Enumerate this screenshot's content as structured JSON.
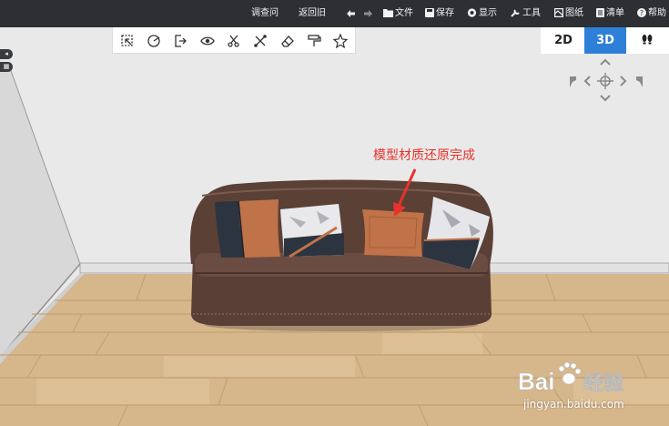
{
  "topbar": {
    "items": [
      {
        "label": "调查问"
      },
      {
        "label": "返回旧"
      },
      {
        "label": "文件",
        "icon": "folder-icon"
      },
      {
        "label": "保存",
        "icon": "save-icon"
      },
      {
        "label": "显示",
        "icon": "eye-icon"
      },
      {
        "label": "工具",
        "icon": "wrench-icon"
      },
      {
        "label": "图纸",
        "icon": "drawing-icon"
      },
      {
        "label": "清单",
        "icon": "list-icon"
      },
      {
        "label": "帮助",
        "icon": "help-icon"
      }
    ],
    "undo_icon": "undo-icon",
    "redo_icon": "redo-icon"
  },
  "palette": {
    "tools": [
      "select-icon",
      "material-brush-icon",
      "exit-group-icon",
      "visibility-icon",
      "cut-icon",
      "scissors-x-icon",
      "eraser-icon",
      "paint-roller-icon",
      "favorite-star-icon"
    ]
  },
  "view_switch": {
    "options": [
      "2D",
      "3D"
    ],
    "active": "3D",
    "walk_icon": "footprint-icon"
  },
  "nav_icons": [
    "pan-up-icon",
    "pan-left-icon",
    "pan-center-icon",
    "pan-right-icon",
    "pan-down-icon",
    "rotate-left-icon",
    "rotate-right-icon"
  ],
  "annotation": {
    "text": "模型材质还原完成",
    "color": "#e8322b"
  },
  "watermark": {
    "logo_text": "Bai经验",
    "domain": "jingyan.baidu.com"
  },
  "colors": {
    "accent": "#2e7fd8",
    "topbar": "#2d2f33",
    "sofa": "#5a3f36",
    "pillow_orange": "#c07248",
    "pillow_navy": "#2c3440",
    "floor": "#d7b88d"
  }
}
